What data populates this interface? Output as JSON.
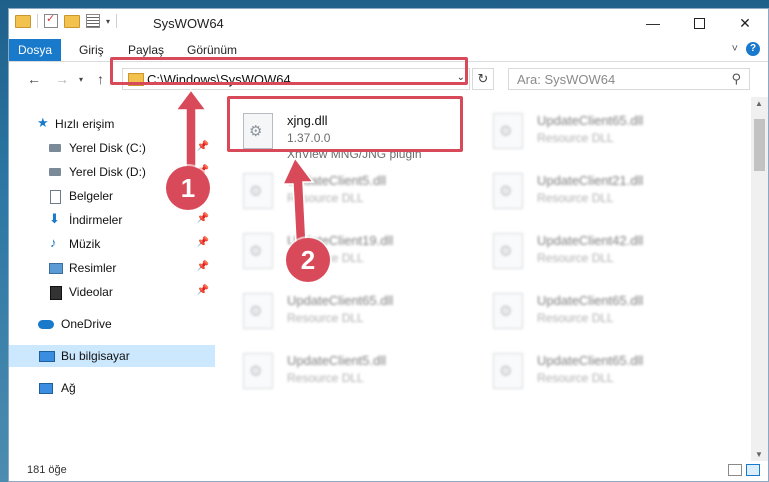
{
  "window": {
    "title": "SysWOW64",
    "controls": {
      "minimize": "—",
      "maximize": "",
      "close": "✕"
    }
  },
  "ribbon": {
    "tabs": [
      {
        "label": "Dosya"
      },
      {
        "label": "Giriş"
      },
      {
        "label": "Paylaş"
      },
      {
        "label": "Görünüm"
      }
    ],
    "help": "?"
  },
  "address": {
    "path": "C:\\Windows\\SysWOW64",
    "search_placeholder": "Ara: SysWOW64"
  },
  "sidebar": {
    "items": [
      {
        "label": "Hızlı erişim"
      },
      {
        "label": "Yerel Disk (C:)"
      },
      {
        "label": "Yerel Disk (D:)"
      },
      {
        "label": "Belgeler"
      },
      {
        "label": "İndirmeler"
      },
      {
        "label": "Müzik"
      },
      {
        "label": "Resimler"
      },
      {
        "label": "Videolar"
      },
      {
        "label": "OneDrive"
      },
      {
        "label": "Bu bilgisayar"
      },
      {
        "label": "Ağ"
      }
    ]
  },
  "files": {
    "highlighted": {
      "name": "xjng.dll",
      "version": "1.37.0.0",
      "description": "XnView MNG/JNG plugin"
    },
    "blurred": [
      {
        "name": "UpdateClient65.dll",
        "type": "Resource DLL"
      },
      {
        "name": "UpdateClient5.dll",
        "type": "Resource DLL"
      },
      {
        "name": "UpdateClient21.dll",
        "type": "Resource DLL"
      },
      {
        "name": "UpdateClient19.dll",
        "type": "Resource DLL"
      },
      {
        "name": "UpdateClient42.dll",
        "type": "Resource DLL"
      },
      {
        "name": "UpdateClient65.dll",
        "type": "Resource DLL"
      },
      {
        "name": "UpdateClient65.dll",
        "type": "Resource DLL"
      },
      {
        "name": "UpdateClient5.dll",
        "type": "Resource DLL"
      },
      {
        "name": "UpdateClient65.dll",
        "type": "Resource DLL"
      }
    ]
  },
  "status": {
    "item_count": "181 öğe"
  },
  "callouts": {
    "one": "1",
    "two": "2"
  },
  "colors": {
    "accent": "#1979ca",
    "callout": "#d84a5a",
    "selected": "#cce8ff"
  }
}
